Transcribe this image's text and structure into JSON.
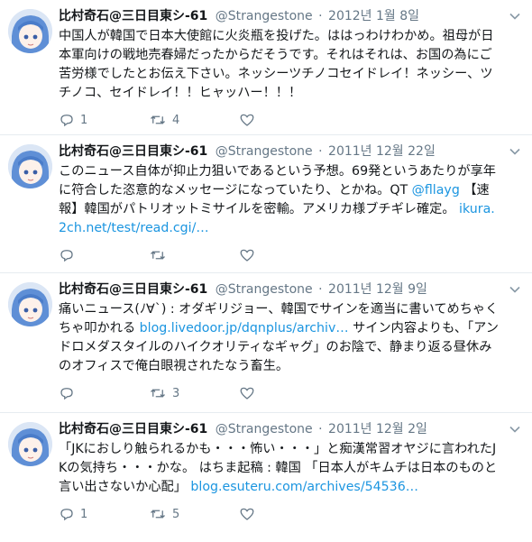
{
  "tweets": [
    {
      "name": "比村奇石@三日目東シ-61",
      "handle": "@Strangestone",
      "dot": "·",
      "date": "2012년 1월 8일",
      "text": "中国人が韓国で日本大使館に火炎瓶を投げた。ははっわけわかめ。祖母が日本軍向けの戦地売春婦だったからだそうです。それはそれは、お国の為にご苦労様でしたとお伝え下さい。ネッシーツチノコセイドレイ！ネッシー、ツチノコ、セイドレイ！！ヒャッハー！！！",
      "replies": "1",
      "retweets": "4",
      "likes": ""
    },
    {
      "name": "比村奇石@三日目東シ-61",
      "handle": "@Strangestone",
      "dot": "·",
      "date": "2011년 12월 22일",
      "text_before": "このニュース自体が抑止力狙いであるという予想。69発というあたりが享年に符合した恣意的なメッセージになっていたり、とかね。QT ",
      "mention": "@fllayg",
      "text_middle": " 【速報】韓国がパトリオットミサイルを密輸。アメリカ様ブチギレ確定。 ",
      "link": "ikura.2ch.net/test/read.cgi/…",
      "replies": "",
      "retweets": "",
      "likes": ""
    },
    {
      "name": "比村奇石@三日目東シ-61",
      "handle": "@Strangestone",
      "dot": "·",
      "date": "2011년 12월 9일",
      "text_before": "痛いニュース(ﾉ∀`) : オダギリジョー、韓国でサインを適当に書いてめちゃくちゃ叩かれる ",
      "link": "blog.livedoor.jp/dqnplus/archiv…",
      "text_after": " サイン内容よりも、「アンドロメダスタイルのハイクオリティなギャグ」のお陰で、静まり返る昼休みのオフィスで俺白眼視されたなう畜生。",
      "replies": "",
      "retweets": "3",
      "likes": ""
    },
    {
      "name": "比村奇石@三日目東シ-61",
      "handle": "@Strangestone",
      "dot": "·",
      "date": "2011년 12월 2일",
      "text_before": "「JKにおしり触られるかも・・・怖い・・・」と痴漢常習オヤジに言われたJKの気持ち・・・かな。 はちま起稿 : 韓国 「日本人がキムチは日本のものと言い出さないか心配」 ",
      "link": "blog.esuteru.com/archives/54536…",
      "replies": "1",
      "retweets": "5",
      "likes": ""
    }
  ],
  "icons": {
    "reply": "reply-icon",
    "retweet": "retweet-icon",
    "like": "heart-icon",
    "caret": "chevron-down-icon",
    "avatar": "avatar"
  },
  "colors": {
    "link": "#1b95e0",
    "muted": "#657786",
    "border": "#e6ecf0"
  }
}
